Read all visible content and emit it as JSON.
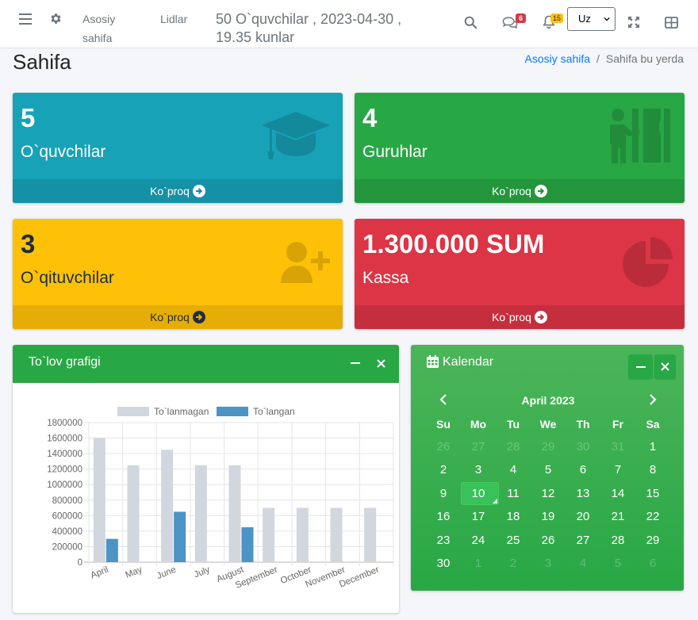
{
  "navbar": {
    "home_link": "Asosiy sahifa",
    "leads_link": "Lidlar",
    "info_text": "50 O`quvchilar , 2023-04-30 , 19.35 kunlar",
    "messages_badge": "6",
    "notifications_badge": "15",
    "language": "Uz",
    "icons": [
      "bars-icon",
      "gear-icon",
      "search-icon",
      "comments-icon",
      "bell-icon",
      "expand-icon",
      "grid-icon"
    ]
  },
  "header": {
    "title": "Sahifa",
    "breadcrumb_home": "Asosiy sahifa",
    "breadcrumb_sep": "/",
    "breadcrumb_current": "Sahifa bu yerda"
  },
  "stats": [
    {
      "value": "5",
      "label": "O`quvchilar",
      "more": "Ko`proq",
      "color": "#17a2b8",
      "icon": "graduation-cap-icon"
    },
    {
      "value": "4",
      "label": "Guruhlar",
      "more": "Ko`proq",
      "color": "#28a745",
      "icon": "chalkboard-teacher-icon"
    },
    {
      "value": "3",
      "label": "O`qituvchilar",
      "more": "Ko`proq",
      "color": "#ffc107",
      "icon": "user-plus-icon"
    },
    {
      "value": "1.300.000 SUM",
      "label": "Kassa",
      "more": "Ko`proq",
      "color": "#dc3545",
      "icon": "chart-pie-icon"
    }
  ],
  "payment_chart": {
    "title": "To`lov grafigi",
    "minimize": "−",
    "close": "×"
  },
  "chart_data": {
    "type": "bar",
    "categories": [
      "April",
      "May",
      "June",
      "July",
      "August",
      "September",
      "October",
      "November",
      "December"
    ],
    "series": [
      {
        "name": "To`lanmagan",
        "color": "#d2d6de",
        "values": [
          1600000,
          1250000,
          1450000,
          1250000,
          1250000,
          700000,
          700000,
          700000,
          700000
        ]
      },
      {
        "name": "To`langan",
        "color": "#4c93c6",
        "values": [
          300000,
          0,
          650000,
          0,
          450000,
          0,
          0,
          0,
          0
        ]
      }
    ],
    "yticks": [
      "1800000",
      "1600000",
      "1400000",
      "1200000",
      "1000000",
      "800000",
      "600000",
      "400000",
      "200000",
      "0"
    ],
    "ylim": [
      0,
      1800000
    ],
    "grid": true,
    "legend": "top"
  },
  "calendar": {
    "title": "Kalendar",
    "month": "April 2023",
    "weekdays": [
      "Su",
      "Mo",
      "Tu",
      "We",
      "Th",
      "Fr",
      "Sa"
    ],
    "days": [
      {
        "d": "26",
        "m": true
      },
      {
        "d": "27",
        "m": true
      },
      {
        "d": "28",
        "m": true
      },
      {
        "d": "29",
        "m": true
      },
      {
        "d": "30",
        "m": true
      },
      {
        "d": "31",
        "m": true
      },
      {
        "d": "1"
      },
      {
        "d": "2"
      },
      {
        "d": "3"
      },
      {
        "d": "4"
      },
      {
        "d": "5"
      },
      {
        "d": "6"
      },
      {
        "d": "7"
      },
      {
        "d": "8"
      },
      {
        "d": "9"
      },
      {
        "d": "10",
        "today": true
      },
      {
        "d": "11"
      },
      {
        "d": "12"
      },
      {
        "d": "13"
      },
      {
        "d": "14"
      },
      {
        "d": "15"
      },
      {
        "d": "16"
      },
      {
        "d": "17"
      },
      {
        "d": "18"
      },
      {
        "d": "19"
      },
      {
        "d": "20"
      },
      {
        "d": "21"
      },
      {
        "d": "22"
      },
      {
        "d": "23"
      },
      {
        "d": "24"
      },
      {
        "d": "25"
      },
      {
        "d": "26"
      },
      {
        "d": "27"
      },
      {
        "d": "28"
      },
      {
        "d": "29"
      },
      {
        "d": "30"
      },
      {
        "d": "1",
        "m": true
      },
      {
        "d": "2",
        "m": true
      },
      {
        "d": "3",
        "m": true
      },
      {
        "d": "4",
        "m": true
      },
      {
        "d": "5",
        "m": true
      },
      {
        "d": "6",
        "m": true
      }
    ]
  }
}
